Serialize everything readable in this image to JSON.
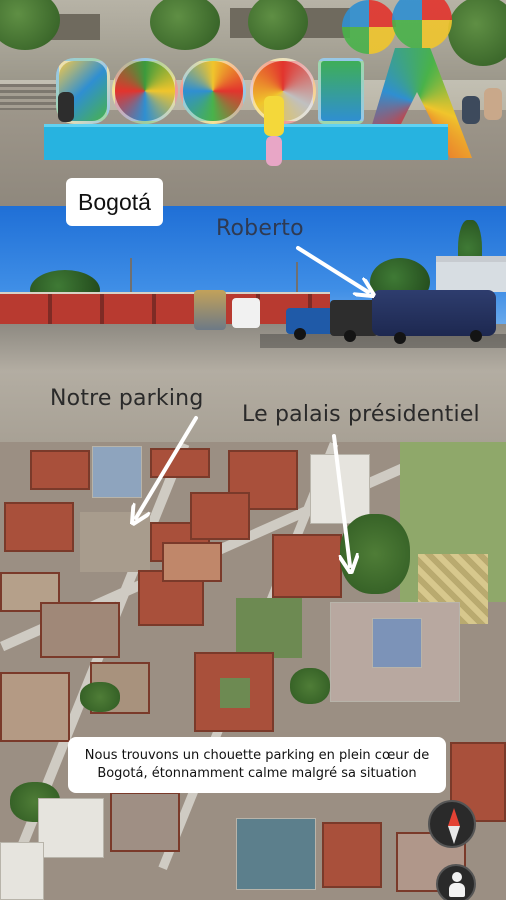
{
  "story": {
    "panels": [
      {
        "id": "bogota-sign"
      },
      {
        "id": "parking-lot"
      },
      {
        "id": "aerial-map"
      }
    ]
  },
  "overlays": {
    "city_label": "Bogotá",
    "vehicle_label": "Roberto",
    "parking_label": "Notre parking",
    "palace_label": "Le palais présidentiel",
    "caption_line1": "Nous trouvons un chouette parking en plein cœur de",
    "caption_line2": "Bogotá, étonnamment calme malgré sa situation"
  },
  "map_controls": {
    "compass_icon": "compass-icon",
    "pegman_icon": "street-view-pegman-icon"
  },
  "colors": {
    "sign_base": "#27b3e0",
    "arrow": "#ffffff",
    "label_bg": "#ffffff",
    "compass_north": "#e34234"
  }
}
